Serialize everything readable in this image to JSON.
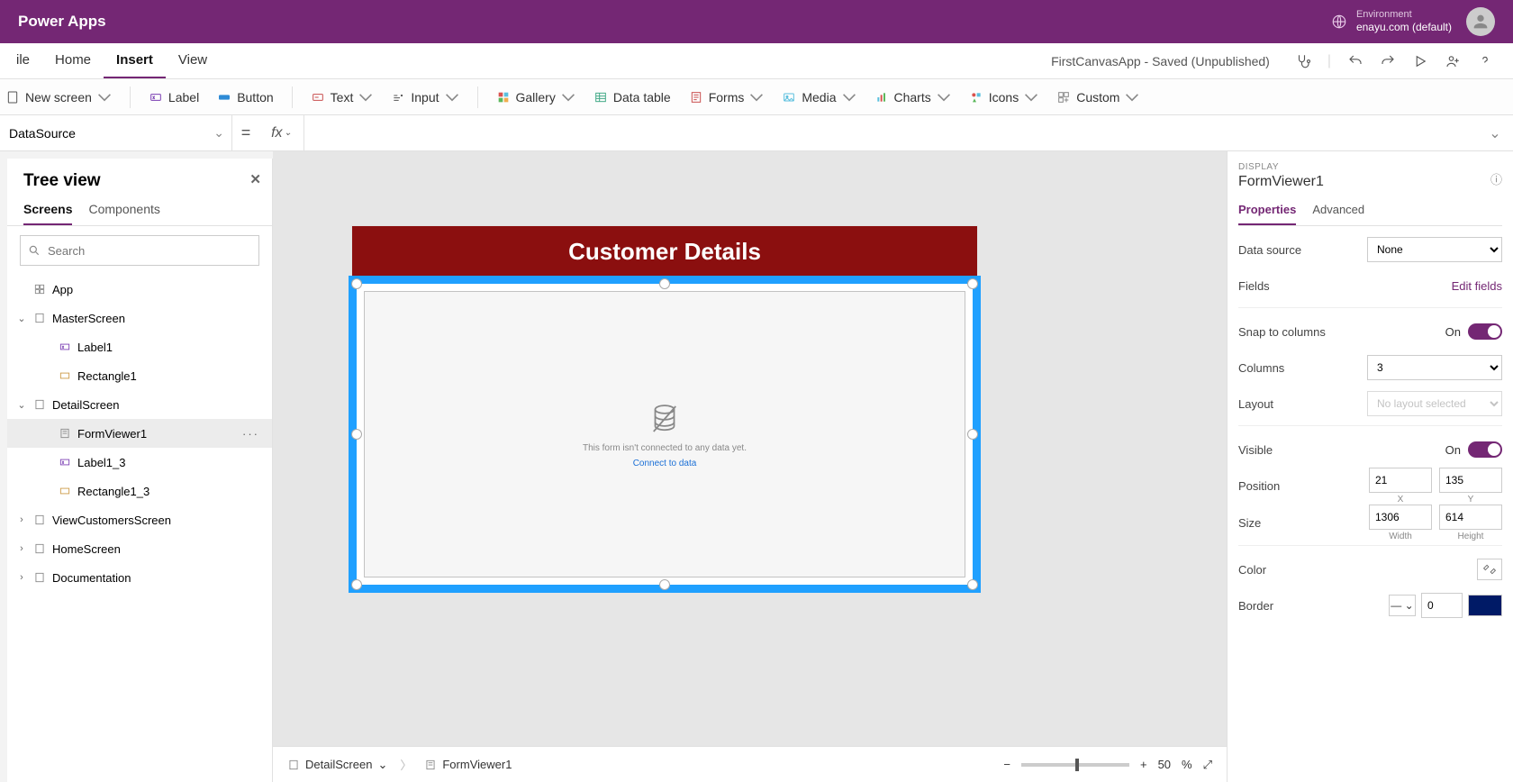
{
  "brand": "Power Apps",
  "environment": {
    "label": "Environment",
    "value": "enayu.com (default)"
  },
  "menu": {
    "file": "ile",
    "home": "Home",
    "insert": "Insert",
    "view": "View",
    "status": "FirstCanvasApp - Saved (Unpublished)"
  },
  "ribbon": {
    "newscreen": "New screen",
    "label": "Label",
    "button": "Button",
    "text": "Text",
    "input": "Input",
    "gallery": "Gallery",
    "datatable": "Data table",
    "forms": "Forms",
    "media": "Media",
    "charts": "Charts",
    "icons": "Icons",
    "custom": "Custom"
  },
  "formula": {
    "prop": "DataSource",
    "eq": "=",
    "fx": "fx",
    "value": ""
  },
  "tree": {
    "title": "Tree view",
    "tabs": {
      "screens": "Screens",
      "components": "Components"
    },
    "search_placeholder": "Search",
    "app": "App",
    "items": {
      "master": "MasterScreen",
      "label1": "Label1",
      "rect1": "Rectangle1",
      "detail": "DetailScreen",
      "formviewer": "FormViewer1",
      "label13": "Label1_3",
      "rect13": "Rectangle1_3",
      "viewcust": "ViewCustomersScreen",
      "homescr": "HomeScreen",
      "doc": "Documentation"
    }
  },
  "canvas": {
    "header": "Customer Details",
    "emptymsg": "This form isn't connected to any data yet.",
    "emptylink": "Connect to data"
  },
  "breadcrumb": {
    "screen": "DetailScreen",
    "control": "FormViewer1",
    "zoom": "50",
    "pct": "%"
  },
  "props": {
    "section": "DISPLAY",
    "objname": "FormViewer1",
    "tabs": {
      "properties": "Properties",
      "advanced": "Advanced"
    },
    "datasource": "Data source",
    "datasource_val": "None",
    "fields": "Fields",
    "editfields": "Edit fields",
    "snap": "Snap to columns",
    "snap_val": "On",
    "columns": "Columns",
    "columns_val": "3",
    "layout": "Layout",
    "layout_val": "No layout selected",
    "visible": "Visible",
    "visible_val": "On",
    "position": "Position",
    "pos_x": "21",
    "pos_y": "135",
    "pos_x_lbl": "X",
    "pos_y_lbl": "Y",
    "size": "Size",
    "sz_w": "1306",
    "sz_h": "614",
    "sz_w_lbl": "Width",
    "sz_h_lbl": "Height",
    "color": "Color",
    "border": "Border",
    "border_val": "0"
  }
}
